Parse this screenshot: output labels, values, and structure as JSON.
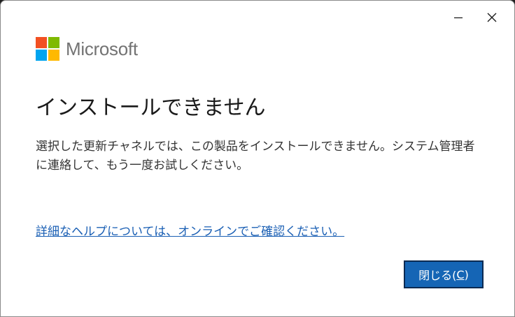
{
  "window": {
    "minimize_icon": "minimize-icon",
    "close_icon": "close-icon"
  },
  "logo": {
    "text": "Microsoft",
    "colors": {
      "red": "#f25022",
      "green": "#7fba00",
      "blue": "#00a4ef",
      "yellow": "#ffb900"
    }
  },
  "dialog": {
    "title": "インストールできません",
    "message": "選択した更新チャネルでは、この製品をインストールできません。システム管理者に連絡して、もう一度お試しください。",
    "help_link": "詳細なヘルプについては、オンラインでご確認ください。",
    "close_button": {
      "label_prefix": "閉じる(",
      "accelerator": "C",
      "label_suffix": ")"
    }
  },
  "colors": {
    "accent": "#1565b5",
    "link": "#1a5fb4"
  }
}
